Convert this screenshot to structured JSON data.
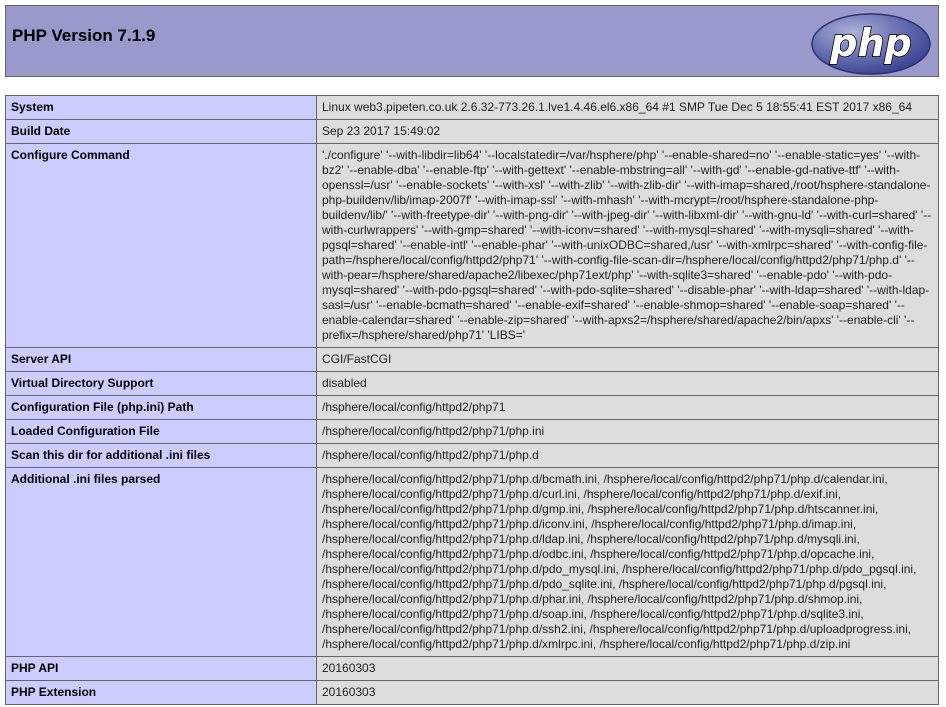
{
  "header": {
    "title": "PHP Version 7.1.9",
    "logo_text": "php"
  },
  "colors": {
    "header_bg": "#9999cc",
    "label_bg": "#ccccff",
    "value_bg": "#dddddd",
    "border": "#666666"
  },
  "rows": [
    {
      "label": "System",
      "value": "Linux web3.pipeten.co.uk 2.6.32-773.26.1.lve1.4.46.el6.x86_64 #1 SMP Tue Dec 5 18:55:41 EST 2017 x86_64"
    },
    {
      "label": "Build Date",
      "value": "Sep 23 2017 15:49:02"
    },
    {
      "label": "Configure Command",
      "value": "'./configure' '--with-libdir=lib64' '--localstatedir=/var/hsphere/php' '--enable-shared=no' '--enable-static=yes' '--with-bz2' '--enable-dba' '--enable-ftp' '--with-gettext' '--enable-mbstring=all' '--with-gd' '--enable-gd-native-ttf' '--with-openssl=/usr' '--enable-sockets' '--with-xsl' '--with-zlib' '--with-zlib-dir' '--with-imap=shared,/root/hsphere-standalone-php-buildenv/lib/imap-2007f' '--with-imap-ssl' '--with-mhash' '--with-mcrypt=/root/hsphere-standalone-php-buildenv/lib/' '--with-freetype-dir' '--with-png-dir' '--with-jpeg-dir' '--with-libxml-dir' '--with-gnu-ld' '--with-curl=shared' '--with-curlwrappers' '--with-gmp=shared' '--with-iconv=shared' '--with-mysql=shared' '--with-mysqli=shared' '--with-pgsql=shared' '--enable-intl' '--enable-phar' '--with-unixODBC=shared,/usr' '--with-xmlrpc=shared' '--with-config-file-path=/hsphere/local/config/httpd2/php71' '--with-config-file-scan-dir=/hsphere/local/config/httpd2/php71/php.d' '--with-pear=/hsphere/shared/apache2/libexec/php71ext/php' '--with-sqlite3=shared' '--enable-pdo' '--with-pdo-mysql=shared' '--with-pdo-pgsql=shared' '--with-pdo-sqlite=shared' '--disable-phar' '--with-ldap=shared' '--with-ldap-sasl=/usr' '--enable-bcmath=shared' '--enable-exif=shared' '--enable-shmop=shared' '--enable-soap=shared' '--enable-calendar=shared' '--enable-zip=shared' '--with-apxs2=/hsphere/shared/apache2/bin/apxs' '--enable-cli' '--prefix=/hsphere/shared/php71' 'LIBS='"
    },
    {
      "label": "Server API",
      "value": "CGI/FastCGI"
    },
    {
      "label": "Virtual Directory Support",
      "value": "disabled"
    },
    {
      "label": "Configuration File (php.ini) Path",
      "value": "/hsphere/local/config/httpd2/php71"
    },
    {
      "label": "Loaded Configuration File",
      "value": "/hsphere/local/config/httpd2/php71/php.ini"
    },
    {
      "label": "Scan this dir for additional .ini files",
      "value": "/hsphere/local/config/httpd2/php71/php.d"
    },
    {
      "label": "Additional .ini files parsed",
      "value": "/hsphere/local/config/httpd2/php71/php.d/bcmath.ini, /hsphere/local/config/httpd2/php71/php.d/calendar.ini, /hsphere/local/config/httpd2/php71/php.d/curl.ini, /hsphere/local/config/httpd2/php71/php.d/exif.ini, /hsphere/local/config/httpd2/php71/php.d/gmp.ini, /hsphere/local/config/httpd2/php71/php.d/htscanner.ini, /hsphere/local/config/httpd2/php71/php.d/iconv.ini, /hsphere/local/config/httpd2/php71/php.d/imap.ini, /hsphere/local/config/httpd2/php71/php.d/ldap.ini, /hsphere/local/config/httpd2/php71/php.d/mysqli.ini, /hsphere/local/config/httpd2/php71/php.d/odbc.ini, /hsphere/local/config/httpd2/php71/php.d/opcache.ini, /hsphere/local/config/httpd2/php71/php.d/pdo_mysql.ini, /hsphere/local/config/httpd2/php71/php.d/pdo_pgsql.ini, /hsphere/local/config/httpd2/php71/php.d/pdo_sqlite.ini, /hsphere/local/config/httpd2/php71/php.d/pgsql.ini, /hsphere/local/config/httpd2/php71/php.d/phar.ini, /hsphere/local/config/httpd2/php71/php.d/shmop.ini, /hsphere/local/config/httpd2/php71/php.d/soap.ini, /hsphere/local/config/httpd2/php71/php.d/sqlite3.ini, /hsphere/local/config/httpd2/php71/php.d/ssh2.ini, /hsphere/local/config/httpd2/php71/php.d/uploadprogress.ini, /hsphere/local/config/httpd2/php71/php.d/xmlrpc.ini, /hsphere/local/config/httpd2/php71/php.d/zip.ini"
    },
    {
      "label": "PHP API",
      "value": "20160303"
    },
    {
      "label": "PHP Extension",
      "value": "20160303"
    }
  ]
}
